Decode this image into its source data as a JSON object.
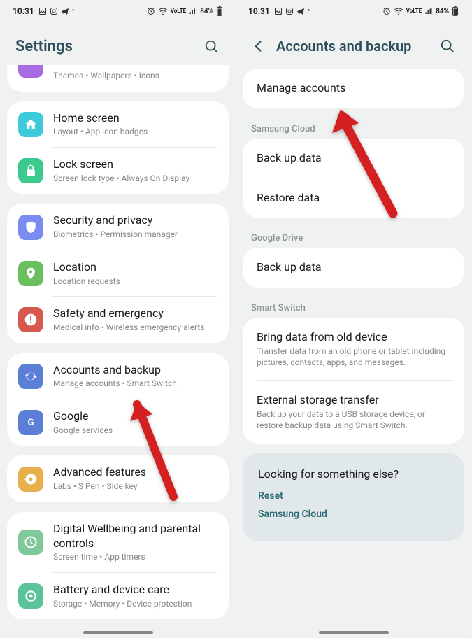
{
  "status": {
    "time": "10:31",
    "battery": "84%",
    "net_label": "VoLTE"
  },
  "left": {
    "title": "Settings",
    "partial_item": {
      "sub": "Themes  •  Wallpapers  •  Icons",
      "icon_color": "#a86ae0"
    },
    "groups": [
      {
        "items": [
          {
            "title": "Home screen",
            "sub": "Layout  •  App icon badges",
            "icon": "home",
            "color": "#3dcbdb"
          },
          {
            "title": "Lock screen",
            "sub": "Screen lock type  •  Always On Display",
            "icon": "lock",
            "color": "#3cc98d"
          }
        ]
      },
      {
        "items": [
          {
            "title": "Security and privacy",
            "sub": "Biometrics  •  Permission manager",
            "icon": "shield",
            "color": "#7a8cf0"
          },
          {
            "title": "Location",
            "sub": "Location requests",
            "icon": "pin",
            "color": "#6abf5e"
          },
          {
            "title": "Safety and emergency",
            "sub": "Medical info  •  Wireless emergency alerts",
            "icon": "alert",
            "color": "#d6584f"
          }
        ]
      },
      {
        "items": [
          {
            "title": "Accounts and backup",
            "sub": "Manage accounts  •  Smart Switch",
            "icon": "sync",
            "color": "#5b7fd6"
          },
          {
            "title": "Google",
            "sub": "Google services",
            "icon": "google",
            "color": "#5b7fd6"
          }
        ]
      },
      {
        "items": [
          {
            "title": "Advanced features",
            "sub": "Labs  •  S Pen  •  Side key",
            "icon": "gear-badge",
            "color": "#e8b04a"
          }
        ]
      },
      {
        "items": [
          {
            "title": "Digital Wellbeing and parental controls",
            "sub": "Screen time  •  App timers",
            "icon": "wellbeing",
            "color": "#7fc89a"
          },
          {
            "title": "Battery and device care",
            "sub": "Storage  •  Memory  •  Device protection",
            "icon": "care",
            "color": "#5bc29a"
          }
        ]
      }
    ]
  },
  "right": {
    "title": "Accounts and backup",
    "top_item": {
      "title": "Manage accounts"
    },
    "sections": [
      {
        "label": "Samsung Cloud",
        "items": [
          {
            "title": "Back up data"
          },
          {
            "title": "Restore data"
          }
        ]
      },
      {
        "label": "Google Drive",
        "items": [
          {
            "title": "Back up data"
          }
        ]
      },
      {
        "label": "Smart Switch",
        "items": [
          {
            "title": "Bring data from old device",
            "sub": "Transfer data from an old phone or tablet including pictures, contacts, apps, and messages."
          },
          {
            "title": "External storage transfer",
            "sub": "Back up your data to a USB storage device, or restore backup data using Smart Switch."
          }
        ]
      }
    ],
    "tail": {
      "heading": "Looking for something else?",
      "links": [
        "Reset",
        "Samsung Cloud"
      ]
    }
  }
}
